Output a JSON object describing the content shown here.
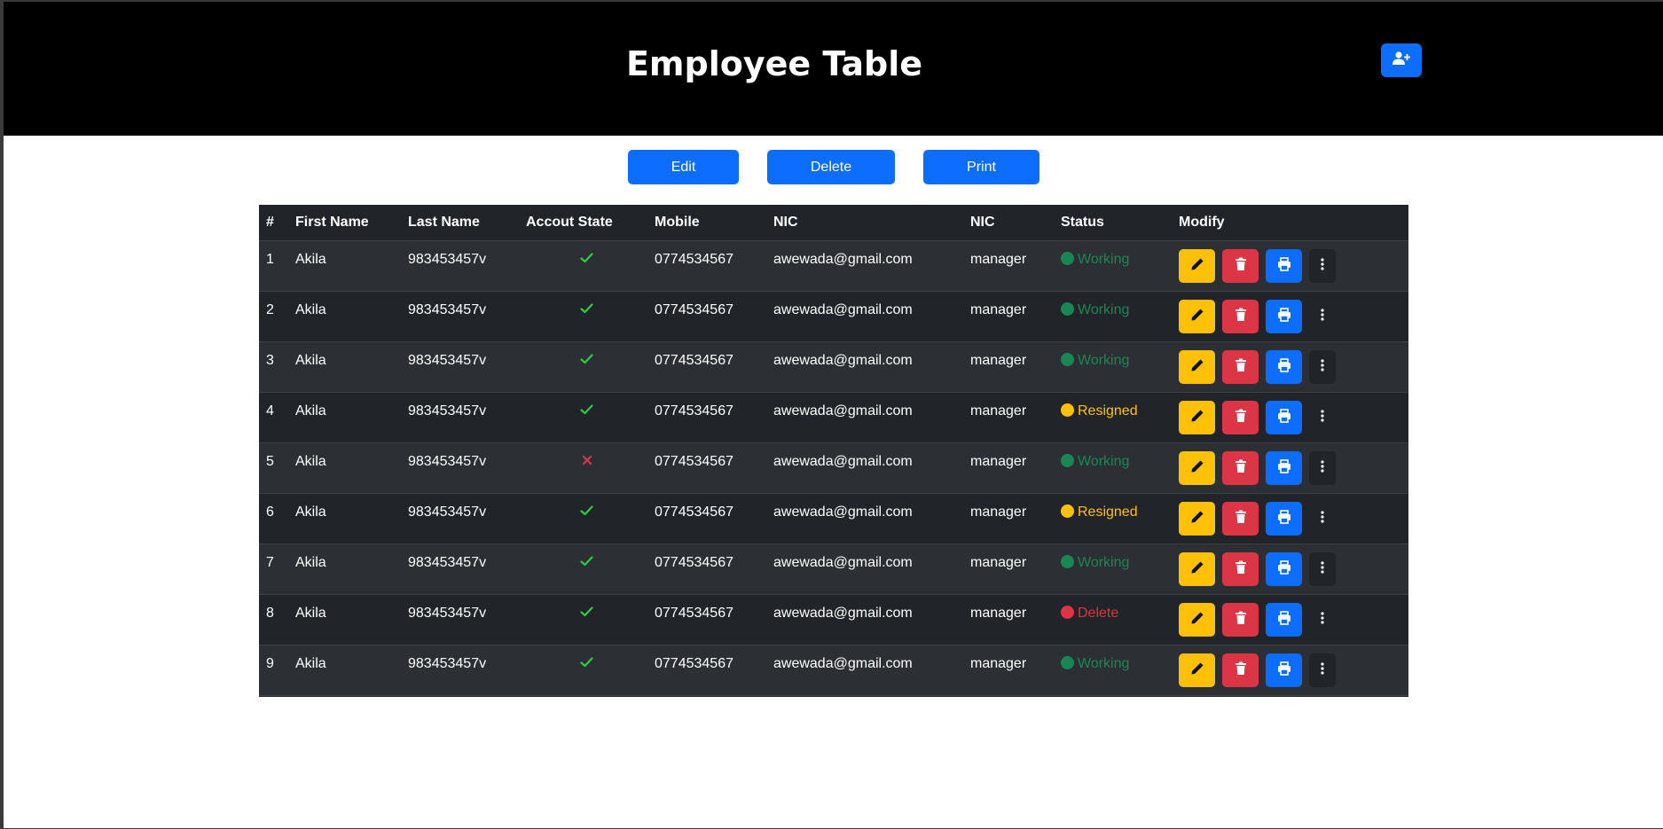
{
  "header": {
    "title": "Employee Table",
    "add_user_icon": "person-plus-icon"
  },
  "toolbar": {
    "edit_label": "Edit",
    "delete_label": "Delete",
    "print_label": "Print"
  },
  "table": {
    "columns": [
      "#",
      "First Name",
      "Last Name",
      "Accout State",
      "Mobile",
      "NIC",
      "NIC",
      "Status",
      "Modify"
    ],
    "rows": [
      {
        "num": "1",
        "first": "Akila",
        "last": "983453457v",
        "state": "active",
        "mobile": "0774534567",
        "email": "awewada@gmail.com",
        "role": "manager",
        "status": "Working"
      },
      {
        "num": "2",
        "first": "Akila",
        "last": "983453457v",
        "state": "active",
        "mobile": "0774534567",
        "email": "awewada@gmail.com",
        "role": "manager",
        "status": "Working"
      },
      {
        "num": "3",
        "first": "Akila",
        "last": "983453457v",
        "state": "active",
        "mobile": "0774534567",
        "email": "awewada@gmail.com",
        "role": "manager",
        "status": "Working"
      },
      {
        "num": "4",
        "first": "Akila",
        "last": "983453457v",
        "state": "active",
        "mobile": "0774534567",
        "email": "awewada@gmail.com",
        "role": "manager",
        "status": "Resigned"
      },
      {
        "num": "5",
        "first": "Akila",
        "last": "983453457v",
        "state": "inactive",
        "mobile": "0774534567",
        "email": "awewada@gmail.com",
        "role": "manager",
        "status": "Working"
      },
      {
        "num": "6",
        "first": "Akila",
        "last": "983453457v",
        "state": "active",
        "mobile": "0774534567",
        "email": "awewada@gmail.com",
        "role": "manager",
        "status": "Resigned"
      },
      {
        "num": "7",
        "first": "Akila",
        "last": "983453457v",
        "state": "active",
        "mobile": "0774534567",
        "email": "awewada@gmail.com",
        "role": "manager",
        "status": "Working"
      },
      {
        "num": "8",
        "first": "Akila",
        "last": "983453457v",
        "state": "active",
        "mobile": "0774534567",
        "email": "awewada@gmail.com",
        "role": "manager",
        "status": "Delete"
      },
      {
        "num": "9",
        "first": "Akila",
        "last": "983453457v",
        "state": "active",
        "mobile": "0774534567",
        "email": "awewada@gmail.com",
        "role": "manager",
        "status": "Working"
      }
    ]
  },
  "colors": {
    "header_bg": "#000000",
    "primary": "#0d6efd",
    "warning": "#ffc107",
    "danger": "#dc3545",
    "table_bg": "#212529",
    "table_stripe": "#2c3034",
    "status_working": "#198754",
    "status_resigned": "#ffc107",
    "status_delete": "#dc3545",
    "check": "#2ecc40",
    "cross": "#dc3545"
  },
  "icons": {
    "check": "check-icon",
    "cross": "x-icon",
    "edit": "pencil-icon",
    "delete": "trash-icon",
    "print": "printer-icon",
    "more": "kebab-menu-icon"
  }
}
